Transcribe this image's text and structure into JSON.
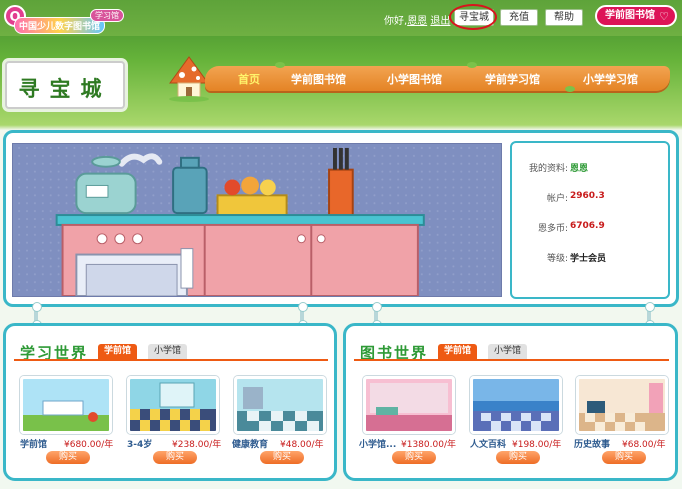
{
  "topbar": {
    "logo_badge": "Q",
    "logo_text": "中国少儿数字图书馆",
    "logo_sub": "学习馆",
    "greeting_prefix": "你好,",
    "username": "恩恩",
    "logout": "退出",
    "buttons": [
      "寻宝城",
      "充值",
      "帮助"
    ],
    "library_button": "学前图书馆",
    "library_icon": "heart-icon"
  },
  "header": {
    "sign": "寻宝城",
    "nav": [
      {
        "label": "首页",
        "active": true
      },
      {
        "label": "学前图书馆",
        "active": false
      },
      {
        "label": "小学图书馆",
        "active": false
      },
      {
        "label": "学前学习馆",
        "active": false
      },
      {
        "label": "小学学习馆",
        "active": false
      }
    ]
  },
  "profile": {
    "rows": [
      {
        "label": "我的资料:",
        "value": "恩恩",
        "color": "#2e9a36"
      },
      {
        "label": "帐户:",
        "value": "2960.3",
        "color": "#c81b1b"
      },
      {
        "label": "恩多币:",
        "value": "6706.9",
        "color": "#c81b1b"
      },
      {
        "label": "等级:",
        "value": "学士会员",
        "color": "#222222"
      }
    ]
  },
  "learning_world": {
    "title": "学习世界",
    "tabs": [
      "学前馆",
      "小学馆"
    ],
    "items": [
      {
        "name": "学前馆",
        "price": "¥680.00/年",
        "buy": "购买"
      },
      {
        "name": "3-4岁",
        "price": "¥238.00/年",
        "buy": "购买"
      },
      {
        "name": "健康教育",
        "price": "¥48.00/年",
        "buy": "购买"
      }
    ]
  },
  "book_world": {
    "title": "图书世界",
    "tabs": [
      "学前馆",
      "小学馆"
    ],
    "items": [
      {
        "name": "小学馆...",
        "price": "¥1380.00/年",
        "buy": "购买"
      },
      {
        "name": "人文百科",
        "price": "¥198.00/年",
        "buy": "购买"
      },
      {
        "name": "历史故事",
        "price": "¥68.00/年",
        "buy": "购买"
      }
    ]
  },
  "colors": {
    "accent_teal": "#3ab7c8",
    "tab_orange": "#ee5a13",
    "title_green": "#2e9a36",
    "price_red": "#c81b1b"
  }
}
